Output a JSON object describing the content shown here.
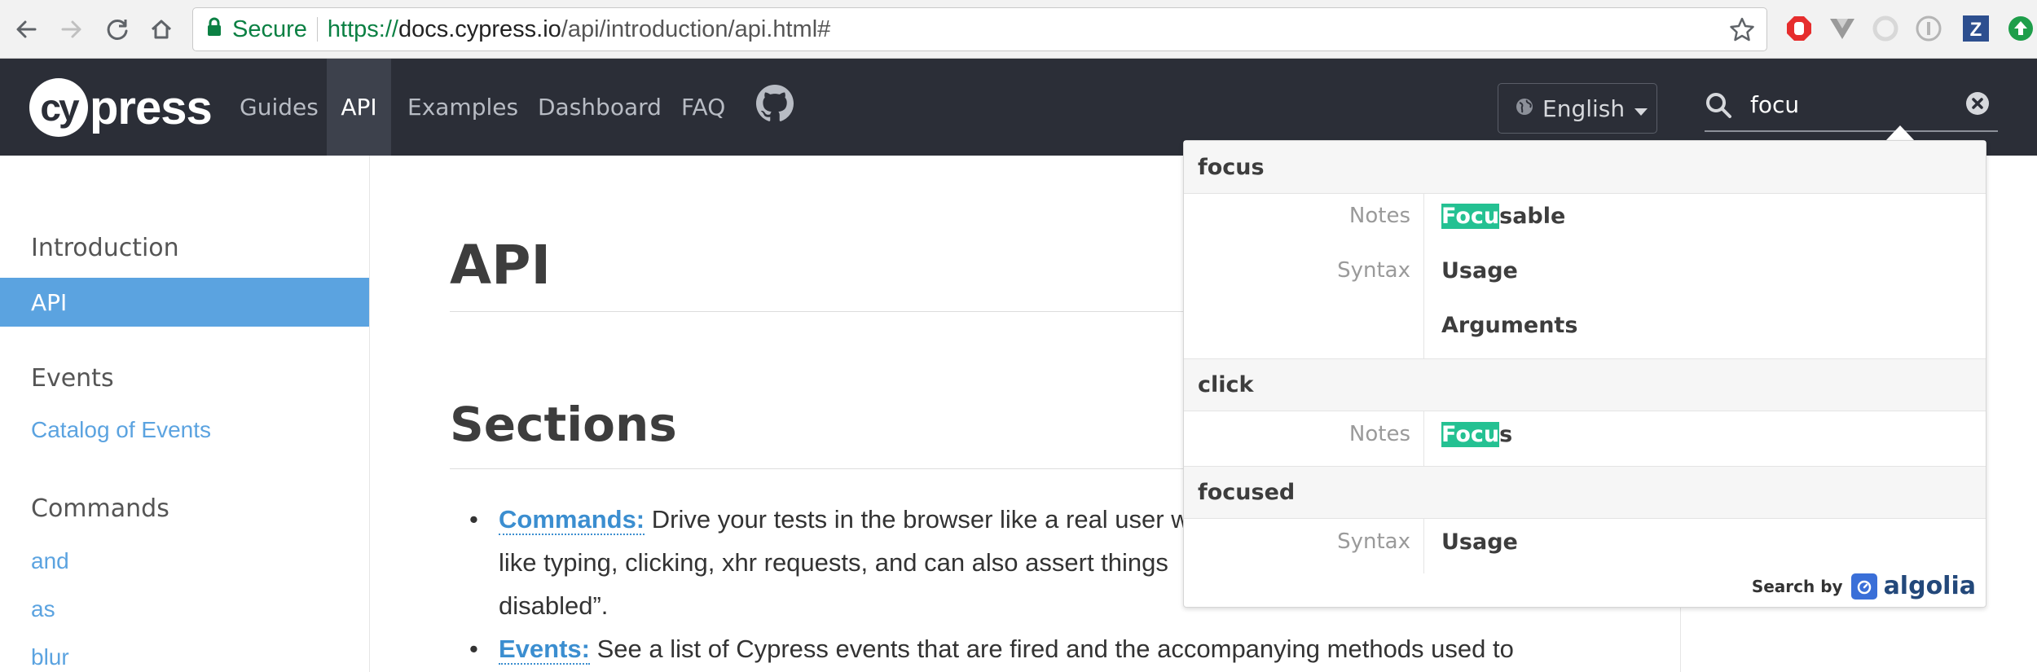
{
  "browser": {
    "secure_label": "Secure",
    "url_protocol": "https://",
    "url_host": "docs.cypress.io",
    "url_path": "/api/introduction/api.html#"
  },
  "header": {
    "logo_mark": "cy",
    "logo_text": "press",
    "nav": [
      "Guides",
      "API",
      "Examples",
      "Dashboard",
      "FAQ"
    ],
    "active_nav": "API",
    "language": "English",
    "search_value": "focu"
  },
  "sidebar": {
    "heading_intro": "Introduction",
    "active_item": "API",
    "heading_events": "Events",
    "events_link": "Catalog of Events",
    "heading_commands": "Commands",
    "command_links": [
      "and",
      "as",
      "blur"
    ]
  },
  "main": {
    "title": "API",
    "section_title": "Sections",
    "bullets": [
      {
        "link": "Commands:",
        "text": " Drive your tests in the browser like a real user w",
        "line2": "like typing, clicking, xhr requests, and can also assert things",
        "line3": "disabled”."
      },
      {
        "link": "Events:",
        "text": " See a list of Cypress events that are fired and the accompanying methods used to"
      }
    ]
  },
  "search_results": {
    "groups": [
      {
        "title": "focus",
        "rows": [
          {
            "category": "Notes",
            "highlight": "Focu",
            "rest": "sable"
          },
          {
            "category": "Syntax",
            "highlight": "",
            "rest": "Usage"
          },
          {
            "category": "",
            "highlight": "",
            "rest": "Arguments"
          }
        ]
      },
      {
        "title": "click",
        "rows": [
          {
            "category": "Notes",
            "highlight": "Focu",
            "rest": "s"
          }
        ]
      },
      {
        "title": "focused",
        "rows": [
          {
            "category": "Syntax",
            "highlight": "",
            "rest": "Usage"
          }
        ]
      }
    ],
    "footer_label": "Search by",
    "footer_brand": "algolia"
  },
  "colors": {
    "header_bg": "#2b2e37",
    "sidebar_active": "#5ba3e0",
    "link": "#3b8ed0",
    "highlight": "#24c192",
    "secure_green": "#0b8043"
  }
}
